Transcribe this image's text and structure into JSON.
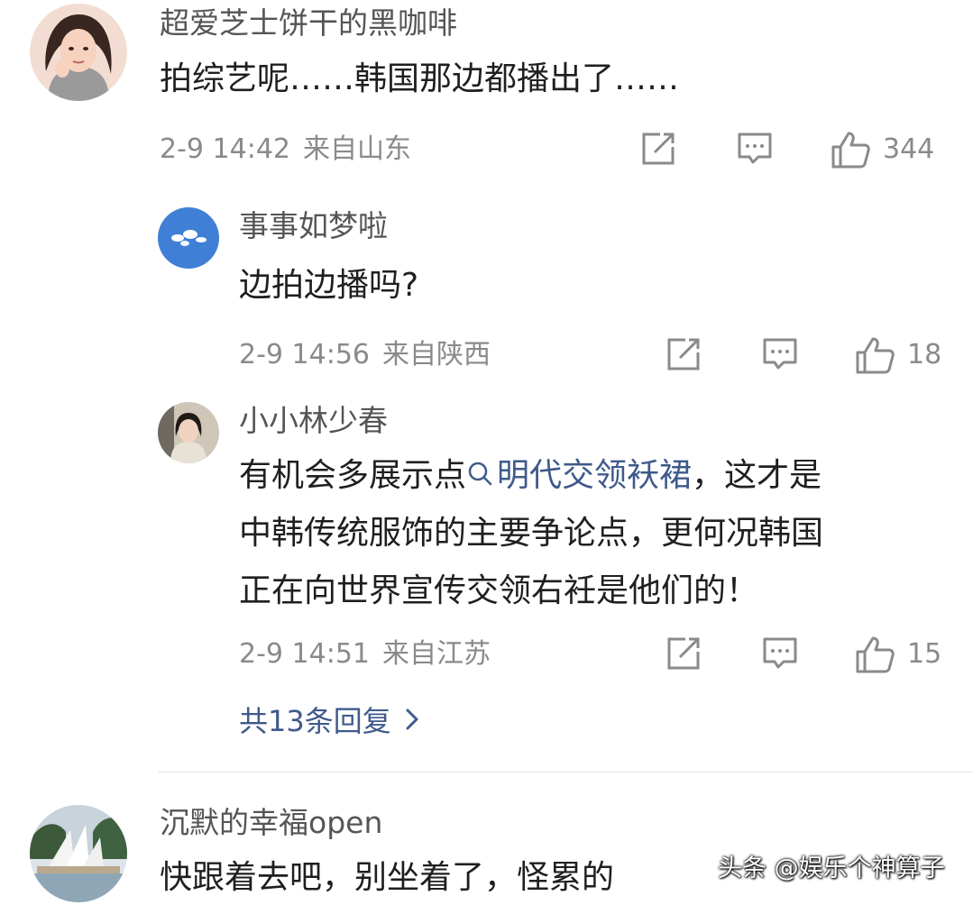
{
  "comments": [
    {
      "username": "超爱芝士饼干的黑咖啡",
      "text": "拍综艺呢……韩国那边都播出了……",
      "time": "2-9 14:42",
      "location": "来自山东",
      "likes": "344",
      "avatar": "woman-illustration-avatar"
    },
    {
      "username": "事事如梦啦",
      "text": "边拍边播吗?",
      "time": "2-9 14:56",
      "location": "来自陕西",
      "likes": "18",
      "avatar": "sky-clouds-avatar"
    },
    {
      "username": "小小林少春",
      "text_line1_prefix": "有机会多展示点",
      "topic_link": "明代交领袄裙",
      "text_line1_suffix": "，这才是",
      "text_line2": "中韩传统服饰的主要争论点，更何况韩国",
      "text_line3": "正在向世界宣传交领右衽是他们的！",
      "time": "2-9 14:51",
      "location": "来自江苏",
      "likes": "15",
      "avatar": "woman-photo-avatar"
    },
    {
      "username": "沉默的幸福open",
      "text": "快跟着去吧，别坐着了，怪累的",
      "avatar": "opera-house-avatar"
    }
  ],
  "replies_link": "共13条回复",
  "watermark": "头条 @娱乐个神算子",
  "colors": {
    "link": "#3f5a8a",
    "meta": "#8a8a8a",
    "username": "#555555",
    "text": "#1f1f1f"
  },
  "icons": [
    "share-icon",
    "comment-icon",
    "like-icon",
    "search-icon",
    "chevron-right-icon"
  ]
}
